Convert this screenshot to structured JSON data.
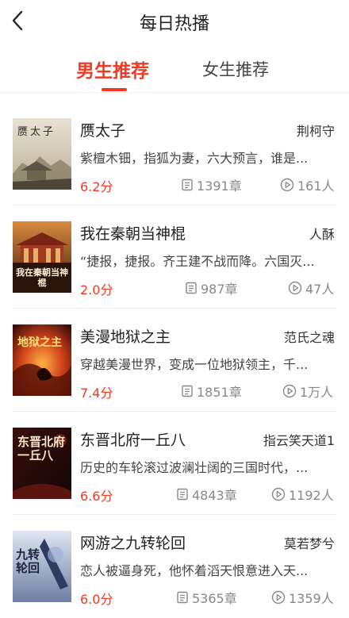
{
  "header": {
    "title": "每日热播",
    "back_icon": "chevron-left-icon"
  },
  "tabs": [
    {
      "label": "男生推荐",
      "active": true
    },
    {
      "label": "女生推荐",
      "active": false
    }
  ],
  "colors": {
    "accent": "#ef3b24",
    "muted": "#888888"
  },
  "icons": {
    "chapter": "document-icon",
    "readers": "play-circle-icon"
  },
  "books": [
    {
      "title": "赝太子",
      "author": "荆柯守",
      "desc": "紫檀木钿，指狐为妻，六大预言，谁是...",
      "score": "6.2分",
      "chapters": "1391章",
      "readers": "161人",
      "cover_text": "赝太子"
    },
    {
      "title": "我在秦朝当神棍",
      "author": "人酥",
      "desc": "“捷报，捷报。齐王建不战而降。六国灭...",
      "score": "2.0分",
      "chapters": "987章",
      "readers": "47人",
      "cover_text": "我在秦朝当神棍"
    },
    {
      "title": "美漫地狱之主",
      "author": "范氏之魂",
      "desc": "穿越美漫世界，变成一位地狱领主，千...",
      "score": "7.4分",
      "chapters": "1851章",
      "readers": "1万人",
      "cover_text": "地狱之主"
    },
    {
      "title": "东晋北府一丘八",
      "author": "指云笑天道1",
      "desc": "历史的车轮滚过波澜壮阔的三国时代，...",
      "score": "6.6分",
      "chapters": "4843章",
      "readers": "1192人",
      "cover_text": "东晋北府一丘八"
    },
    {
      "title": "网游之九转轮回",
      "author": "莫若梦兮",
      "desc": "恋人被逼身死，他怀着滔天恨意进入天...",
      "score": "6.0分",
      "chapters": "5365章",
      "readers": "1359人",
      "cover_text": "九转轮回"
    }
  ]
}
